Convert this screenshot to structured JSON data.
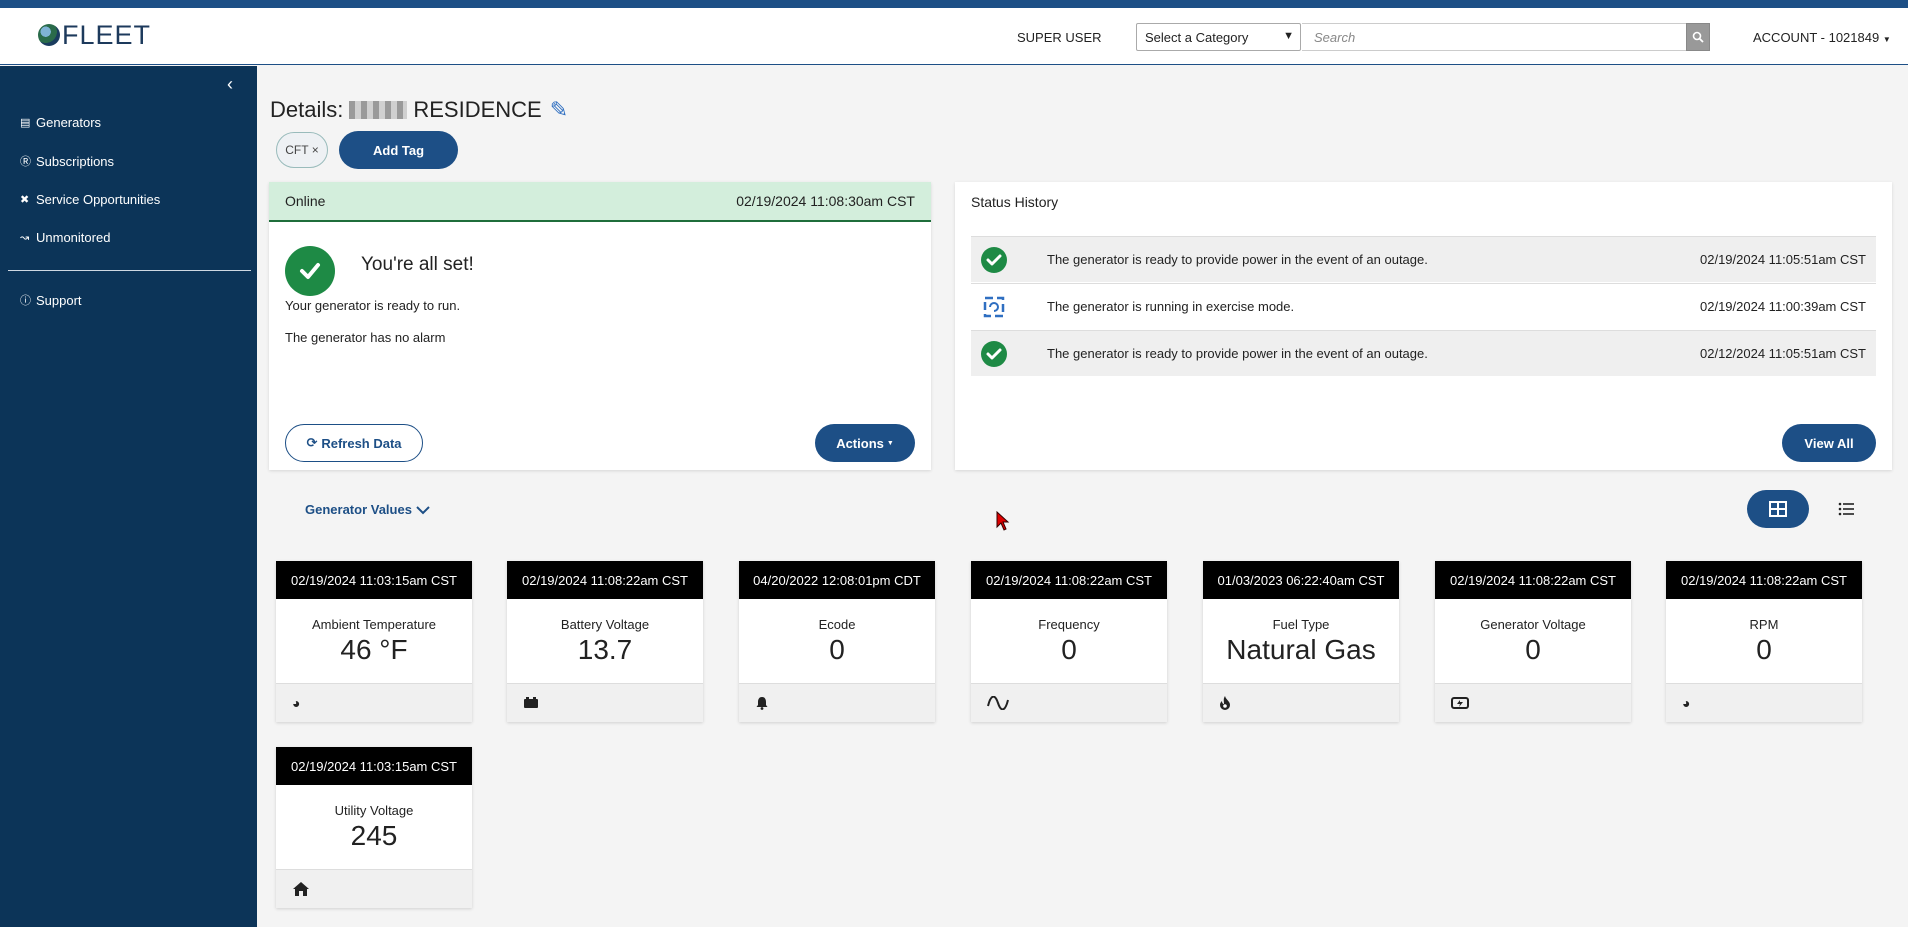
{
  "header": {
    "logo_text": "FLEET",
    "user_role": "SUPER USER",
    "category_select": "Select a Category",
    "search_placeholder": "Search",
    "account": "ACCOUNT - 1021849"
  },
  "sidebar": {
    "items": [
      {
        "label": "Generators",
        "icon": "generator-icon"
      },
      {
        "label": "Subscriptions",
        "icon": "dollar-icon"
      },
      {
        "label": "Service Opportunities",
        "icon": "tools-icon"
      },
      {
        "label": "Unmonitored",
        "icon": "chart-line-icon"
      },
      {
        "label": "Support",
        "icon": "question-icon"
      }
    ]
  },
  "page": {
    "title_prefix": "Details:",
    "title_suffix": "RESIDENCE",
    "tag_label": "CFT ×",
    "add_tag_label": "Add Tag"
  },
  "status": {
    "state": "Online",
    "timestamp": "02/19/2024 11:08:30am CST",
    "headline": "You're all set!",
    "line1": "Your generator is ready to run.",
    "line2": "The generator has no alarm",
    "refresh_label": "Refresh Data",
    "actions_label": "Actions"
  },
  "history": {
    "title": "Status History",
    "rows": [
      {
        "icon": "check-circle-icon",
        "text": "The generator is ready to provide power in the event of an outage.",
        "time": "02/19/2024 11:05:51am CST"
      },
      {
        "icon": "exercise-cycle-icon",
        "text": "The generator is running in exercise mode.",
        "time": "02/19/2024 11:00:39am CST"
      },
      {
        "icon": "check-circle-icon",
        "text": "The generator is ready to provide power in the event of an outage.",
        "time": "02/12/2024 11:05:51am CST"
      }
    ],
    "view_all_label": "View All"
  },
  "values": {
    "toggle_label": "Generator Values",
    "tiles": [
      {
        "time": "02/19/2024 11:03:15am CST",
        "label": "Ambient Temperature",
        "value": "46 °F",
        "icon": "gauge-icon"
      },
      {
        "time": "02/19/2024 11:08:22am CST",
        "label": "Battery Voltage",
        "value": "13.7",
        "icon": "battery-icon"
      },
      {
        "time": "04/20/2022 12:08:01pm CDT",
        "label": "Ecode",
        "value": "0",
        "icon": "bell-icon"
      },
      {
        "time": "02/19/2024 11:08:22am CST",
        "label": "Frequency",
        "value": "0",
        "icon": "sine-wave-icon"
      },
      {
        "time": "01/03/2023 06:22:40am CST",
        "label": "Fuel Type",
        "value": "Natural Gas",
        "icon": "flame-icon"
      },
      {
        "time": "02/19/2024 11:08:22am CST",
        "label": "Generator Voltage",
        "value": "0",
        "icon": "car-battery-icon"
      },
      {
        "time": "02/19/2024 11:08:22am CST",
        "label": "RPM",
        "value": "0",
        "icon": "tachometer-icon"
      },
      {
        "time": "02/19/2024 11:03:15am CST",
        "label": "Utility Voltage",
        "value": "245",
        "icon": "home-icon"
      }
    ]
  }
}
